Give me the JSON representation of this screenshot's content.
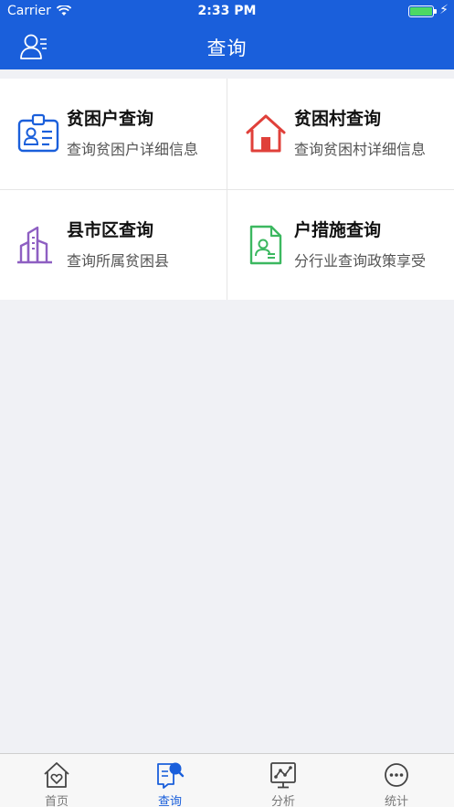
{
  "status": {
    "carrier": "Carrier",
    "time": "2:33 PM"
  },
  "header": {
    "title": "查询",
    "user_icon": "user-list-icon"
  },
  "colors": {
    "brand": "#1a5fdb",
    "house_red": "#e0403a",
    "village_text_blue": "#1a5fdb",
    "county_purple": "#8e5fc2",
    "measure_green": "#3cb860"
  },
  "grid": {
    "items": [
      {
        "title": "贫困户查询",
        "subtitle": "查询贫困户详细信息",
        "icon": "id-card-icon"
      },
      {
        "title": "贫困村查询",
        "subtitle": "查询贫困村详细信息",
        "icon": "house-icon"
      },
      {
        "title": "县市区查询",
        "subtitle": "查询所属贫困县",
        "icon": "city-buildings-icon"
      },
      {
        "title": "户措施查询",
        "subtitle": "分行业查询政策享受",
        "icon": "document-person-icon"
      }
    ]
  },
  "tabbar": {
    "tabs": [
      {
        "label": "首页",
        "icon": "home-heart-icon",
        "active": false
      },
      {
        "label": "查询",
        "icon": "search-doc-icon",
        "active": true
      },
      {
        "label": "分析",
        "icon": "analysis-board-icon",
        "active": false
      },
      {
        "label": "统计",
        "icon": "more-circle-icon",
        "active": false
      }
    ]
  }
}
